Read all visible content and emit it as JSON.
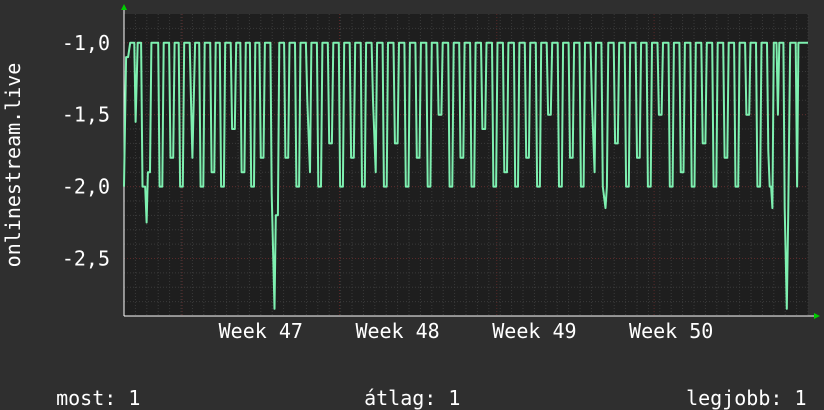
{
  "colors": {
    "background": "#2f2f2f",
    "plot_background": "#1e1e1e",
    "grid_minor": "#3a3a3a",
    "grid_major": "#5a2a2a",
    "line": "#7ef0b0",
    "text": "#ffffff",
    "axis_arrow": "#00cc00"
  },
  "chart_data": {
    "type": "line",
    "ylabel": "onlinestream.live",
    "ylim": [
      -2.9,
      -0.8
    ],
    "yticks": [
      -1.0,
      -1.5,
      -2.0,
      -2.5
    ],
    "ytick_labels": [
      "-1,0",
      "-1,5",
      "-2,0",
      "-2,5"
    ],
    "xlim": [
      0,
      100
    ],
    "xticks": [
      {
        "x": 20,
        "label": "Week 47"
      },
      {
        "x": 40,
        "label": "Week 48"
      },
      {
        "x": 60,
        "label": "Week 49"
      },
      {
        "x": 80,
        "label": "Week 50"
      }
    ],
    "grid": true,
    "series": [
      {
        "values": [
          [
            0,
            -2.0
          ],
          [
            0.3,
            -1.1
          ],
          [
            0.6,
            -1.1
          ],
          [
            0.9,
            -1.0
          ],
          [
            1.5,
            -1.0
          ],
          [
            1.7,
            -1.55
          ],
          [
            2.0,
            -1.0
          ],
          [
            2.5,
            -1.0
          ],
          [
            2.7,
            -2.0
          ],
          [
            3.1,
            -2.0
          ],
          [
            3.3,
            -2.25
          ],
          [
            3.5,
            -1.9
          ],
          [
            3.8,
            -1.9
          ],
          [
            4.0,
            -1.0
          ],
          [
            5.0,
            -1.0
          ],
          [
            5.2,
            -2.0
          ],
          [
            5.6,
            -2.0
          ],
          [
            5.8,
            -1.0
          ],
          [
            6.6,
            -1.0
          ],
          [
            6.8,
            -1.8
          ],
          [
            7.2,
            -1.8
          ],
          [
            7.4,
            -1.0
          ],
          [
            8.0,
            -1.0
          ],
          [
            8.2,
            -2.0
          ],
          [
            8.6,
            -2.0
          ],
          [
            8.8,
            -1.0
          ],
          [
            9.6,
            -1.0
          ],
          [
            9.8,
            -1.4
          ],
          [
            10.0,
            -1.8
          ],
          [
            10.4,
            -1.0
          ],
          [
            11.0,
            -1.0
          ],
          [
            11.2,
            -2.0
          ],
          [
            11.6,
            -2.0
          ],
          [
            11.8,
            -1.0
          ],
          [
            12.6,
            -1.0
          ],
          [
            12.8,
            -1.9
          ],
          [
            13.2,
            -1.9
          ],
          [
            13.4,
            -1.0
          ],
          [
            14.0,
            -1.0
          ],
          [
            14.2,
            -2.0
          ],
          [
            14.6,
            -2.0
          ],
          [
            14.8,
            -1.0
          ],
          [
            15.6,
            -1.0
          ],
          [
            15.8,
            -1.6
          ],
          [
            16.2,
            -1.6
          ],
          [
            16.4,
            -1.0
          ],
          [
            17.0,
            -1.0
          ],
          [
            17.2,
            -1.9
          ],
          [
            17.6,
            -1.9
          ],
          [
            17.8,
            -1.0
          ],
          [
            18.4,
            -1.0
          ],
          [
            18.6,
            -2.0
          ],
          [
            19.0,
            -2.0
          ],
          [
            19.2,
            -1.0
          ],
          [
            19.8,
            -1.0
          ],
          [
            20.0,
            -1.8
          ],
          [
            20.4,
            -1.8
          ],
          [
            20.6,
            -1.0
          ],
          [
            21.4,
            -1.0
          ],
          [
            21.6,
            -2.05
          ],
          [
            22.0,
            -2.85
          ],
          [
            22.2,
            -2.2
          ],
          [
            22.5,
            -2.2
          ],
          [
            22.7,
            -1.0
          ],
          [
            23.4,
            -1.0
          ],
          [
            23.6,
            -1.8
          ],
          [
            24.0,
            -1.8
          ],
          [
            24.2,
            -1.0
          ],
          [
            25.0,
            -1.0
          ],
          [
            25.2,
            -2.0
          ],
          [
            25.6,
            -2.0
          ],
          [
            25.8,
            -1.0
          ],
          [
            26.6,
            -1.0
          ],
          [
            26.8,
            -1.4
          ],
          [
            27.2,
            -1.9
          ],
          [
            27.4,
            -1.0
          ],
          [
            28.2,
            -1.0
          ],
          [
            28.4,
            -2.0
          ],
          [
            28.8,
            -2.0
          ],
          [
            29.0,
            -1.0
          ],
          [
            29.8,
            -1.0
          ],
          [
            30.0,
            -1.7
          ],
          [
            30.4,
            -1.7
          ],
          [
            30.6,
            -1.0
          ],
          [
            31.4,
            -1.0
          ],
          [
            31.6,
            -2.0
          ],
          [
            32.0,
            -2.0
          ],
          [
            32.2,
            -1.0
          ],
          [
            33.0,
            -1.0
          ],
          [
            33.2,
            -1.8
          ],
          [
            33.6,
            -1.8
          ],
          [
            33.8,
            -1.0
          ],
          [
            34.6,
            -1.0
          ],
          [
            34.8,
            -2.0
          ],
          [
            35.2,
            -2.0
          ],
          [
            35.4,
            -1.0
          ],
          [
            36.2,
            -1.0
          ],
          [
            36.4,
            -1.4
          ],
          [
            36.8,
            -1.9
          ],
          [
            37.0,
            -1.0
          ],
          [
            37.8,
            -1.0
          ],
          [
            38.0,
            -2.0
          ],
          [
            38.4,
            -2.0
          ],
          [
            38.6,
            -1.0
          ],
          [
            39.4,
            -1.0
          ],
          [
            39.6,
            -1.7
          ],
          [
            40.0,
            -1.7
          ],
          [
            40.2,
            -1.0
          ],
          [
            41.0,
            -1.0
          ],
          [
            41.2,
            -2.0
          ],
          [
            41.6,
            -2.0
          ],
          [
            41.8,
            -1.0
          ],
          [
            42.6,
            -1.0
          ],
          [
            42.8,
            -1.8
          ],
          [
            43.2,
            -1.8
          ],
          [
            43.4,
            -1.0
          ],
          [
            44.2,
            -1.0
          ],
          [
            44.4,
            -2.0
          ],
          [
            44.8,
            -2.0
          ],
          [
            45.0,
            -1.0
          ],
          [
            45.8,
            -1.0
          ],
          [
            46.0,
            -1.5
          ],
          [
            46.4,
            -1.5
          ],
          [
            46.6,
            -1.0
          ],
          [
            47.4,
            -1.0
          ],
          [
            47.6,
            -2.0
          ],
          [
            48.0,
            -2.0
          ],
          [
            48.2,
            -1.0
          ],
          [
            49.0,
            -1.0
          ],
          [
            49.2,
            -1.8
          ],
          [
            49.6,
            -1.8
          ],
          [
            49.8,
            -1.0
          ],
          [
            50.6,
            -1.0
          ],
          [
            50.8,
            -2.0
          ],
          [
            51.2,
            -2.0
          ],
          [
            51.4,
            -1.0
          ],
          [
            52.2,
            -1.0
          ],
          [
            52.4,
            -1.6
          ],
          [
            52.8,
            -1.6
          ],
          [
            53.0,
            -1.0
          ],
          [
            53.8,
            -1.0
          ],
          [
            54.0,
            -2.0
          ],
          [
            54.4,
            -2.0
          ],
          [
            54.6,
            -1.0
          ],
          [
            55.4,
            -1.0
          ],
          [
            55.6,
            -1.9
          ],
          [
            56.0,
            -1.9
          ],
          [
            56.2,
            -1.0
          ],
          [
            57.0,
            -1.0
          ],
          [
            57.2,
            -2.0
          ],
          [
            57.6,
            -2.0
          ],
          [
            57.8,
            -1.0
          ],
          [
            58.6,
            -1.0
          ],
          [
            58.8,
            -1.8
          ],
          [
            59.2,
            -1.8
          ],
          [
            59.4,
            -1.0
          ],
          [
            60.2,
            -1.0
          ],
          [
            60.4,
            -2.0
          ],
          [
            60.8,
            -2.0
          ],
          [
            61.0,
            -1.0
          ],
          [
            61.8,
            -1.0
          ],
          [
            62.0,
            -1.5
          ],
          [
            62.4,
            -1.5
          ],
          [
            62.6,
            -1.0
          ],
          [
            63.4,
            -1.0
          ],
          [
            63.6,
            -2.0
          ],
          [
            64.0,
            -2.0
          ],
          [
            64.2,
            -1.0
          ],
          [
            65.0,
            -1.0
          ],
          [
            65.2,
            -1.8
          ],
          [
            65.6,
            -1.8
          ],
          [
            65.8,
            -1.0
          ],
          [
            66.6,
            -1.0
          ],
          [
            66.8,
            -2.0
          ],
          [
            67.2,
            -2.0
          ],
          [
            67.4,
            -1.0
          ],
          [
            68.2,
            -1.0
          ],
          [
            68.4,
            -1.4
          ],
          [
            68.8,
            -1.9
          ],
          [
            69.0,
            -1.0
          ],
          [
            69.8,
            -1.0
          ],
          [
            70.0,
            -2.0
          ],
          [
            70.4,
            -2.15
          ],
          [
            70.6,
            -2.0
          ],
          [
            70.8,
            -1.0
          ],
          [
            71.6,
            -1.0
          ],
          [
            71.8,
            -1.7
          ],
          [
            72.2,
            -1.7
          ],
          [
            72.4,
            -1.0
          ],
          [
            73.2,
            -1.0
          ],
          [
            73.4,
            -2.0
          ],
          [
            73.8,
            -2.0
          ],
          [
            74.0,
            -1.0
          ],
          [
            74.8,
            -1.0
          ],
          [
            75.0,
            -1.8
          ],
          [
            75.4,
            -1.8
          ],
          [
            75.6,
            -1.0
          ],
          [
            76.4,
            -1.0
          ],
          [
            76.6,
            -2.0
          ],
          [
            77.0,
            -2.0
          ],
          [
            77.2,
            -1.0
          ],
          [
            78.0,
            -1.0
          ],
          [
            78.2,
            -1.5
          ],
          [
            78.6,
            -1.5
          ],
          [
            78.8,
            -1.0
          ],
          [
            79.6,
            -1.0
          ],
          [
            79.8,
            -2.0
          ],
          [
            80.2,
            -2.0
          ],
          [
            80.4,
            -1.0
          ],
          [
            81.2,
            -1.0
          ],
          [
            81.4,
            -1.9
          ],
          [
            81.8,
            -1.9
          ],
          [
            82.0,
            -1.0
          ],
          [
            82.8,
            -1.0
          ],
          [
            83.0,
            -2.0
          ],
          [
            83.4,
            -2.0
          ],
          [
            83.6,
            -1.0
          ],
          [
            84.4,
            -1.0
          ],
          [
            84.6,
            -1.7
          ],
          [
            85.0,
            -1.7
          ],
          [
            85.2,
            -1.0
          ],
          [
            86.0,
            -1.0
          ],
          [
            86.2,
            -2.0
          ],
          [
            86.6,
            -2.0
          ],
          [
            86.8,
            -1.0
          ],
          [
            87.6,
            -1.0
          ],
          [
            87.8,
            -1.8
          ],
          [
            88.2,
            -1.8
          ],
          [
            88.4,
            -1.0
          ],
          [
            89.2,
            -1.0
          ],
          [
            89.4,
            -2.0
          ],
          [
            89.8,
            -2.0
          ],
          [
            90.0,
            -1.0
          ],
          [
            90.8,
            -1.0
          ],
          [
            91.0,
            -1.5
          ],
          [
            91.4,
            -1.5
          ],
          [
            91.6,
            -1.0
          ],
          [
            92.4,
            -1.0
          ],
          [
            92.6,
            -2.0
          ],
          [
            93.0,
            -2.0
          ],
          [
            93.2,
            -1.0
          ],
          [
            94.0,
            -1.0
          ],
          [
            94.2,
            -1.75
          ],
          [
            94.4,
            -2.0
          ],
          [
            94.6,
            -2.0
          ],
          [
            94.8,
            -2.15
          ],
          [
            95.0,
            -1.0
          ],
          [
            95.4,
            -1.0
          ],
          [
            95.6,
            -1.5
          ],
          [
            95.8,
            -1.0
          ],
          [
            96.4,
            -1.0
          ],
          [
            96.6,
            -2.15
          ],
          [
            96.9,
            -2.85
          ],
          [
            97.1,
            -2.2
          ],
          [
            97.4,
            -1.0
          ],
          [
            98.2,
            -1.0
          ],
          [
            98.4,
            -2.0
          ],
          [
            98.6,
            -1.0
          ],
          [
            100,
            -1.0
          ]
        ]
      }
    ]
  },
  "legend": {
    "current_label": "most:",
    "current_value": "1",
    "average_label": "átlag:",
    "average_value": "1",
    "max_label": "legjobb:",
    "max_value": "1"
  }
}
